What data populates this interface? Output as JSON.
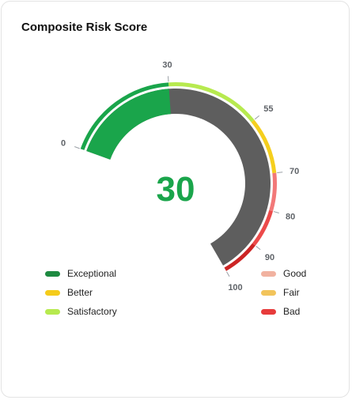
{
  "title": "Composite Risk Score",
  "chart_data": {
    "type": "gauge",
    "value": 30,
    "display_value": "30",
    "min": 0,
    "max": 100,
    "value_color": "#1aa54b",
    "fill_color": "#1aa54b",
    "track_color": "#5e5e5e",
    "ticks": [
      0,
      30,
      55,
      70,
      80,
      90,
      100
    ],
    "tick_labels": [
      "0",
      "30",
      "55",
      "70",
      "80",
      "90",
      "100"
    ],
    "color_bands": [
      {
        "from": 0,
        "to": 30,
        "color": "#1aa54b"
      },
      {
        "from": 30,
        "to": 55,
        "color": "#b7ea4f"
      },
      {
        "from": 55,
        "to": 70,
        "color": "#f5cf1e"
      },
      {
        "from": 70,
        "to": 80,
        "color": "#f27878"
      },
      {
        "from": 80,
        "to": 90,
        "color": "#ec4a4a"
      },
      {
        "from": 90,
        "to": 100,
        "color": "#cc2424"
      }
    ],
    "legend": [
      {
        "label": "Exceptional",
        "color": "#1e8a41"
      },
      {
        "label": "Better",
        "color": "#f5cc1a"
      },
      {
        "label": "Satisfactory",
        "color": "#b7ea4f"
      },
      {
        "label": "Good",
        "color": "#f1b2a0"
      },
      {
        "label": "Fair",
        "color": "#f2c45b"
      },
      {
        "label": "Bad",
        "color": "#e73b3b"
      }
    ]
  }
}
